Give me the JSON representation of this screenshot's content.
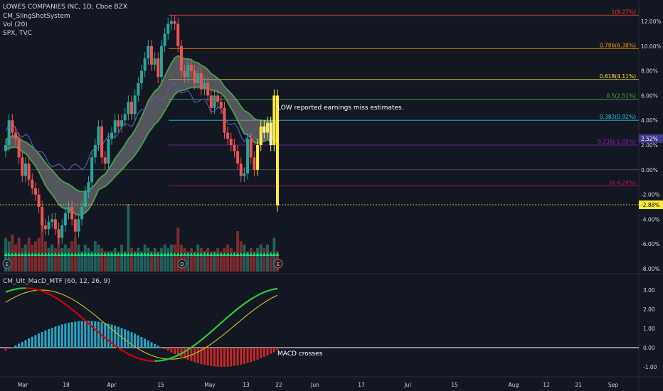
{
  "header": {
    "title": "LOWES COMPANIES INC, 1D, Cboe BZX",
    "indicator1": "CM_SlingShotSystem",
    "indicator2": "Vol (20)",
    "indicator3": "SPX, TVC"
  },
  "colors": {
    "background": "#131722",
    "up": "#26a69a",
    "down": "#ef5350",
    "fill_zone": "#8a8a8a",
    "ema_glow": "#4caf50",
    "spx_line": "#5b56b8",
    "macd_green": "#2ecc40",
    "macd_red": "#d50000",
    "signal": "#c0b820"
  },
  "chart_data": [
    {
      "type": "candlestick",
      "title": "LOWES COMPANIES INC, 1D, Cboe BZX",
      "yscale": "percent",
      "ylim": [
        -8.0,
        13.0
      ],
      "y_ticks": [
        "12.00%",
        "10.00%",
        "8.00%",
        "6.00%",
        "4.00%",
        "2.00%",
        "0.00%",
        "-2.00%",
        "-4.00%",
        "-6.00%",
        "-8.00%"
      ],
      "x_ticks": [
        "Mar",
        "18",
        "Apr",
        "15",
        "May",
        "13",
        "22",
        "Jun",
        "17",
        "Jul",
        "15",
        "Aug",
        "12",
        "21",
        "Sep"
      ],
      "candles_close_pct": [
        2.0,
        4.0,
        3.0,
        2.5,
        1.0,
        -0.5,
        0.5,
        -0.8,
        -1.5,
        -2.0,
        -3.0,
        -4.5,
        -4.8,
        -4.2,
        -4.0,
        -4.8,
        -5.5,
        -4.5,
        -3.5,
        -3.0,
        -4.0,
        -5.0,
        -4.0,
        -3.0,
        -1.8,
        -1.0,
        1.0,
        2.0,
        3.5,
        1.0,
        0.5,
        2.5,
        3.0,
        4.0,
        3.5,
        4.0,
        4.5,
        5.5,
        4.5,
        6.0,
        7.0,
        8.0,
        9.0,
        10.0,
        8.5,
        9.0,
        7.5,
        10.0,
        11.0,
        11.8,
        12.0,
        11.8,
        10.0,
        8.0,
        7.5,
        8.5,
        8.0,
        7.0,
        7.8,
        6.5,
        7.0,
        6.0,
        5.0,
        6.0,
        5.5,
        5.0,
        3.0,
        2.5,
        2.0,
        1.5,
        0.5,
        -0.5,
        -0.3,
        2.5,
        1.0,
        0.0,
        2.0,
        3.5,
        3.0,
        3.8,
        2.0,
        6.0,
        -2.88
      ],
      "volume_rel": [
        0.5,
        0.45,
        0.55,
        0.4,
        0.5,
        0.35,
        0.4,
        0.5,
        0.4,
        0.45,
        0.5,
        0.8,
        0.45,
        0.35,
        0.4,
        0.35,
        0.6,
        0.35,
        0.4,
        0.35,
        0.45,
        0.5,
        0.4,
        0.3,
        0.4,
        0.35,
        0.3,
        0.45,
        0.4,
        0.35,
        0.3,
        0.3,
        0.3,
        0.35,
        0.3,
        0.4,
        0.3,
        1.0,
        0.35,
        0.3,
        0.35,
        0.3,
        0.4,
        0.35,
        0.3,
        0.35,
        0.3,
        0.35,
        0.4,
        0.35,
        0.4,
        0.4,
        0.65,
        0.4,
        0.35,
        0.3,
        0.35,
        0.3,
        0.4,
        0.35,
        0.3,
        0.35,
        0.3,
        0.3,
        0.35,
        0.3,
        0.35,
        0.4,
        0.35,
        0.3,
        0.6,
        0.45,
        0.4,
        0.3,
        0.35,
        0.3,
        0.35,
        0.4,
        0.35,
        0.4,
        0.3,
        0.5,
        0.3
      ],
      "fib_levels": [
        {
          "label": "1(9.27%)",
          "value": 12.5,
          "color": "#e53935"
        },
        {
          "label": "0.786(6.38%)",
          "value": 9.8,
          "color": "#ff9800"
        },
        {
          "label": "0.618(4.11%)",
          "value": 7.3,
          "color": "#ffeb3b"
        },
        {
          "label": "0.5(2.51%)",
          "value": 5.7,
          "color": "#4caf50"
        },
        {
          "label": "0.382(0.92%)",
          "value": 4.0,
          "color": "#26c6da"
        },
        {
          "label": "0.236(-1.05%)",
          "value": 2.0,
          "color": "#8e24aa"
        },
        {
          "label": "0(-4.24%)",
          "value": -1.3,
          "color": "#c51162"
        }
      ],
      "price_tag": "2.52%",
      "last_tag": "-2.88%",
      "annotation": "LOW reported earnings miss estimates.",
      "event_markers": [
        "E",
        "D",
        "E"
      ]
    },
    {
      "type": "line",
      "title": "CM_Ult_MacD_MTF (60, 12, 26, 9)",
      "ylim": [
        -1.25,
        3.5
      ],
      "y_ticks": [
        "3.00",
        "2.00",
        "1.00",
        "0.00",
        "-1.00"
      ],
      "annotation": "MACD crosses"
    }
  ]
}
